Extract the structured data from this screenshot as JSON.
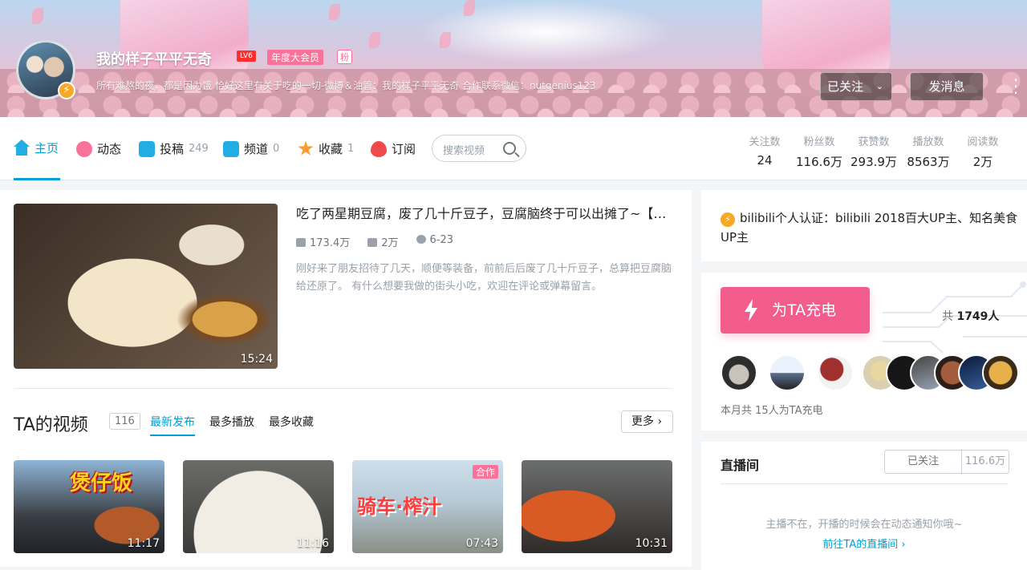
{
  "profile": {
    "username": "我的样子平平无奇",
    "level": "LV6",
    "vip": "年度大会员",
    "fan_badge": "粉",
    "verify_badge_icon": "lightning-icon",
    "signature": "所有难熬的夜，都是因为饿 恰好这里有关于吃的一切-微博＆油管：我的样子平平无奇 合作联系微信：nutgenius123",
    "follow_label": "已关注",
    "message_label": "发消息"
  },
  "nav": {
    "tabs": [
      {
        "label": "主页",
        "count": "",
        "icon": "home-icon",
        "color": "#23ade5"
      },
      {
        "label": "动态",
        "count": "",
        "icon": "dynamic-icon",
        "color": "#fb7299"
      },
      {
        "label": "投稿",
        "count": "249",
        "icon": "upload-icon",
        "color": "#23ade5"
      },
      {
        "label": "频道",
        "count": "0",
        "icon": "channel-icon",
        "color": "#23ade5"
      },
      {
        "label": "收藏",
        "count": "1",
        "icon": "star-icon",
        "color": "#ff9a2e"
      },
      {
        "label": "订阅",
        "count": "",
        "icon": "heart-icon",
        "color": "#f04a4a"
      }
    ],
    "search_placeholder": "搜索视频"
  },
  "stats": [
    {
      "label": "关注数",
      "value": "24"
    },
    {
      "label": "粉丝数",
      "value": "116.6万"
    },
    {
      "label": "获赞数",
      "value": "293.9万"
    },
    {
      "label": "播放数",
      "value": "8563万"
    },
    {
      "label": "阅读数",
      "value": "2万"
    }
  ],
  "featured": {
    "title": "吃了两星期豆腐，废了几十斤豆子，豆腐脑终于可以出摊了~【…",
    "plays": "173.4万",
    "danmaku": "2万",
    "date": "6-23",
    "desc": "刚好来了朋友招待了几天，顺便等装备，前前后后废了几十斤豆子，总算把豆腐脑给还原了。 有什么想要我做的街头小吃，欢迎在评论或弹幕留言。",
    "duration": "15:24"
  },
  "videos_section": {
    "title": "TA的视频",
    "count": "116",
    "tabs": [
      "最新发布",
      "最多播放",
      "最多收藏"
    ],
    "more": "更多",
    "items": [
      {
        "caption": "煲仔饭",
        "duration": "11:17",
        "coop": ""
      },
      {
        "caption": "",
        "duration": "11:16",
        "coop": ""
      },
      {
        "caption": "骑车·榨汁",
        "duration": "07:43",
        "coop": "合作"
      },
      {
        "caption": "",
        "duration": "10:31",
        "coop": ""
      }
    ]
  },
  "cert": {
    "text": "bilibili个人认证：bilibili 2018百大UP主、知名美食UP主"
  },
  "charge": {
    "button": "为TA充电",
    "total_prefix": "共",
    "total_value": "1749人",
    "note": "本月共 15人为TA充电"
  },
  "live": {
    "title": "直播间",
    "follow": "已关注",
    "fans": "116.6万",
    "message": "主播不在，开播的时候会在动态通知你哦~",
    "link": "前往TA的直播间"
  },
  "colors": {
    "accent": "#00a1d6",
    "pink": "#fb7299",
    "charge": "#f25d8e"
  }
}
